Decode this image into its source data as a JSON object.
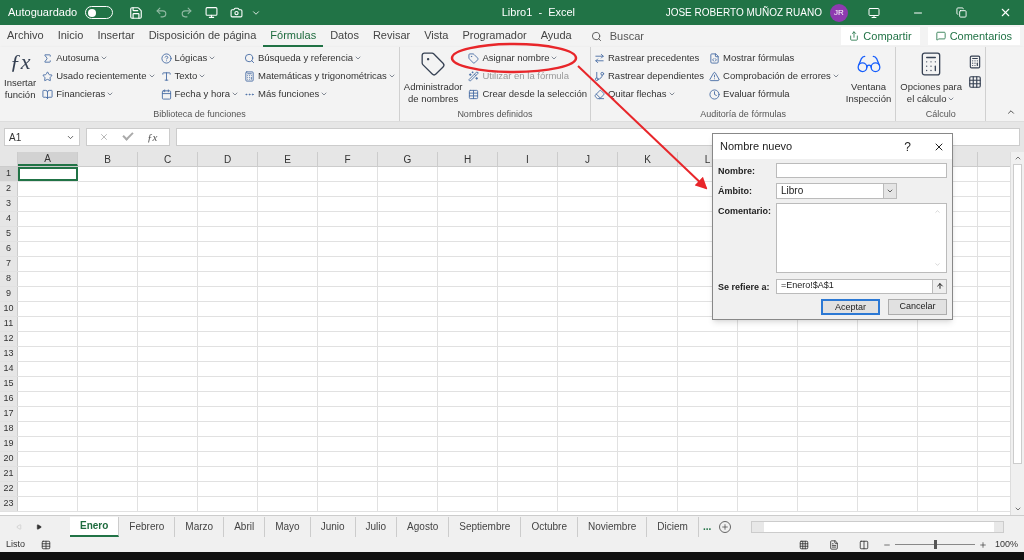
{
  "title_bar": {
    "autosave_label": "Autoguardado",
    "autosave_on": false,
    "title": "Libro1  -  Excel",
    "user": "JOSE ROBERTO MUÑOZ RUANO",
    "avatar": "JR"
  },
  "menu_tabs": [
    {
      "label": "Archivo",
      "selected": false
    },
    {
      "label": "Inicio",
      "selected": false
    },
    {
      "label": "Insertar",
      "selected": false
    },
    {
      "label": "Disposición de página",
      "selected": false
    },
    {
      "label": "Fórmulas",
      "selected": true
    },
    {
      "label": "Datos",
      "selected": false
    },
    {
      "label": "Revisar",
      "selected": false
    },
    {
      "label": "Vista",
      "selected": false
    },
    {
      "label": "Programador",
      "selected": false
    },
    {
      "label": "Ayuda",
      "selected": false
    }
  ],
  "search": {
    "placeholder": "Buscar"
  },
  "share_button": "Compartir",
  "comments_button": "Comentarios",
  "ribbon": [
    {
      "label": "Biblioteca de funciones",
      "items": [
        {
          "kind": "large",
          "glyph": "ƒx",
          "lines": [
            "Insertar",
            "función"
          ],
          "dropdown": false
        },
        {
          "kind": "column",
          "entries": [
            {
              "label": "Autosuma",
              "dropdown": true,
              "disabled": false
            },
            {
              "label": "Usado recientemente",
              "dropdown": true,
              "disabled": false
            },
            {
              "label": "Financieras",
              "dropdown": true,
              "disabled": false
            }
          ]
        },
        {
          "kind": "column",
          "entries": [
            {
              "label": "Lógicas",
              "dropdown": true,
              "disabled": false
            },
            {
              "label": "Texto",
              "dropdown": true,
              "disabled": false
            },
            {
              "label": "Fecha y hora",
              "dropdown": true,
              "disabled": false
            }
          ]
        },
        {
          "kind": "column",
          "entries": [
            {
              "label": "Búsqueda y referencia",
              "dropdown": true,
              "disabled": false
            },
            {
              "label": "Matemáticas y trigonométricas",
              "dropdown": true,
              "disabled": false
            },
            {
              "label": "Más funciones",
              "dropdown": true,
              "disabled": false
            }
          ]
        }
      ]
    },
    {
      "label": "Nombres definidos",
      "items": [
        {
          "kind": "large",
          "lines": [
            "Administrador",
            "de nombres"
          ],
          "dropdown": false
        },
        {
          "kind": "column",
          "entries": [
            {
              "label": "Asignar nombre",
              "dropdown": true,
              "disabled": false
            },
            {
              "label": "Utilizar en la fórmula",
              "dropdown": false,
              "disabled": true
            },
            {
              "label": "Crear desde la selección",
              "dropdown": false,
              "disabled": false
            }
          ]
        }
      ]
    },
    {
      "label": "Auditoría de fórmulas",
      "items": [
        {
          "kind": "column",
          "entries": [
            {
              "label": "Rastrear precedentes",
              "dropdown": false,
              "disabled": false
            },
            {
              "label": "Rastrear dependientes",
              "dropdown": false,
              "disabled": false
            },
            {
              "label": "Quitar flechas",
              "dropdown": true,
              "disabled": false
            }
          ]
        },
        {
          "kind": "column",
          "entries": [
            {
              "label": "Mostrar fórmulas",
              "dropdown": false,
              "disabled": false
            },
            {
              "label": "Comprobación de errores",
              "dropdown": true,
              "disabled": false
            },
            {
              "label": "Evaluar fórmula",
              "dropdown": false,
              "disabled": false
            }
          ]
        },
        {
          "kind": "large",
          "lines": [
            "Ventana",
            "Inspección"
          ],
          "dropdown": false
        }
      ]
    },
    {
      "label": "Cálculo",
      "items": [
        {
          "kind": "large",
          "lines": [
            "Opciones para",
            "el cálculo"
          ],
          "dropdown": true
        },
        {
          "kind": "icons"
        }
      ]
    }
  ],
  "name_box": "A1",
  "formula_glyph": "ƒx",
  "columns": [
    "A",
    "B",
    "C",
    "D",
    "E",
    "F",
    "G",
    "H",
    "I",
    "J",
    "K",
    "L"
  ],
  "rows": [
    "1",
    "2",
    "3",
    "4",
    "5",
    "6",
    "7",
    "8",
    "9",
    "10",
    "11",
    "12",
    "13",
    "14",
    "15",
    "16",
    "17",
    "18",
    "19",
    "20",
    "21",
    "22",
    "23"
  ],
  "dialog": {
    "title": "Nombre nuevo",
    "help": "?",
    "fields": [
      {
        "kind": "text",
        "label": "Nombre:"
      },
      {
        "kind": "select",
        "label": "Ámbito:",
        "value": "Libro"
      },
      {
        "kind": "textarea",
        "label": "Comentario:"
      },
      {
        "kind": "ref",
        "label": "Se refiere a:",
        "value": "=Enero!$A$1"
      }
    ],
    "buttons": [
      {
        "label": "Aceptar",
        "default": true
      },
      {
        "label": "Cancelar",
        "default": false
      }
    ]
  },
  "sheets": [
    {
      "label": "Enero",
      "selected": true
    },
    {
      "label": "Febrero",
      "selected": false
    },
    {
      "label": "Marzo",
      "selected": false
    },
    {
      "label": "Abril",
      "selected": false
    },
    {
      "label": "Mayo",
      "selected": false
    },
    {
      "label": "Junio",
      "selected": false
    },
    {
      "label": "Julio",
      "selected": false
    },
    {
      "label": "Agosto",
      "selected": false
    },
    {
      "label": "Septiembre",
      "selected": false
    },
    {
      "label": "Octubre",
      "selected": false
    },
    {
      "label": "Noviembre",
      "selected": false
    },
    {
      "label": "Diciem",
      "selected": false
    }
  ],
  "more_sheets": "...",
  "status": "Listo",
  "zoom": {
    "level": 0.5,
    "reading": "100%"
  }
}
